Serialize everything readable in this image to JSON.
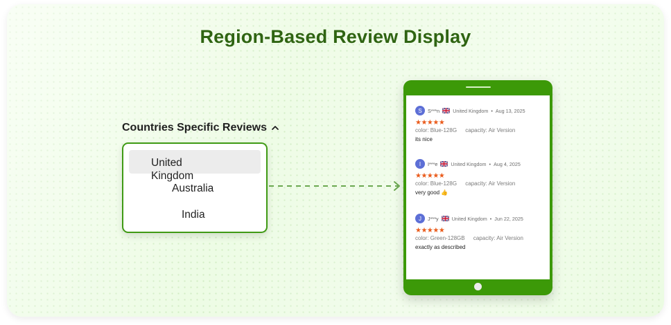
{
  "title": "Region-Based Review Display",
  "dropdown": {
    "header": "Countries Specific Reviews",
    "options": [
      "United Kingdom",
      "Australia",
      "India"
    ],
    "selected": "United Kingdom"
  },
  "reviews": [
    {
      "avatar": "S",
      "user": "S***n",
      "country": "United Kingdom",
      "date": "Aug 13, 2025",
      "stars": "★★★★★",
      "color": "Blue-128G",
      "capacity": "Air Version",
      "text": "its nice"
    },
    {
      "avatar": "I",
      "user": "I***e",
      "country": "United Kingdom",
      "date": "Aug 4, 2025",
      "stars": "★★★★★",
      "color": "Blue-128G",
      "capacity": "Air Version",
      "text": "very good 👍"
    },
    {
      "avatar": "J",
      "user": "J***y",
      "country": "United Kingdom",
      "date": "Jun 22, 2025",
      "stars": "★★★★★",
      "color": "Green-128GB",
      "capacity": "Air Version",
      "text": "exactly as described"
    }
  ],
  "labels": {
    "color": "color:",
    "capacity": "capacity:",
    "separator": "•"
  },
  "colors": {
    "brand_green": "#3c9908",
    "title_green": "#2f6412",
    "star_orange": "#ea5b1b",
    "avatar_blue": "#5d6fd6"
  },
  "icons": {
    "chevron": "chevron-up-icon",
    "flag": "uk-flag-icon",
    "arrow": "dashed-arrow-right-icon"
  }
}
